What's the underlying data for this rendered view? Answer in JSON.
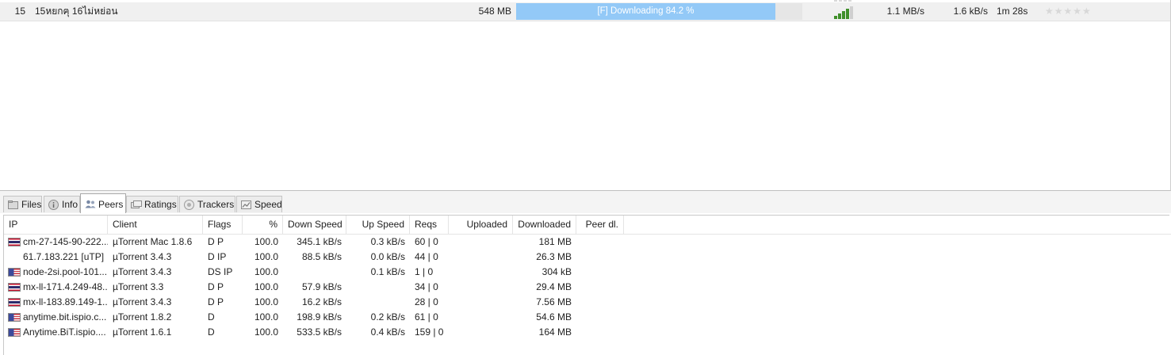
{
  "torrent": {
    "number": "15",
    "name": "15หยกฅุ 16ไม่หย่อน",
    "size": "548 MB",
    "status_text": "[F] Downloading 84.2 %",
    "progress_percent": 84.2,
    "health_bars": 4,
    "down_speed": "1.1 MB/s",
    "up_speed": "1.6 kB/s",
    "eta": "1m 28s",
    "rating_stars": "★★★★★",
    "rating_value": 0
  },
  "tabs": [
    {
      "label": "Files",
      "icon": "files-icon"
    },
    {
      "label": "Info",
      "icon": "info-icon"
    },
    {
      "label": "Peers",
      "icon": "peers-icon",
      "active": true
    },
    {
      "label": "Ratings",
      "icon": "ratings-icon"
    },
    {
      "label": "Trackers",
      "icon": "trackers-icon"
    },
    {
      "label": "Speed",
      "icon": "speed-icon"
    }
  ],
  "peers": {
    "columns": [
      "IP",
      "Client",
      "Flags",
      "%",
      "Down Speed",
      "Up Speed",
      "Reqs",
      "Uploaded",
      "Downloaded",
      "Peer dl."
    ],
    "rows": [
      {
        "flag": "th",
        "ip": "cm-27-145-90-222....",
        "client": "µTorrent Mac 1.8.6",
        "flags": "D P",
        "percent": "100.0",
        "down": "345.1 kB/s",
        "up": "0.3 kB/s",
        "reqs": "60 | 0",
        "uploaded": "",
        "downloaded": "181 MB",
        "peer_dl": ""
      },
      {
        "flag": "",
        "ip": "61.7.183.221 [uTP]",
        "client": "µTorrent 3.4.3",
        "flags": "D IP",
        "percent": "100.0",
        "down": "88.5 kB/s",
        "up": "0.0 kB/s",
        "reqs": "44 | 0",
        "uploaded": "",
        "downloaded": "26.3 MB",
        "peer_dl": ""
      },
      {
        "flag": "us",
        "ip": "node-2si.pool-101....",
        "client": "µTorrent 3.4.3",
        "flags": "DS IP",
        "percent": "100.0",
        "down": "",
        "up": "0.1 kB/s",
        "reqs": "1 | 0",
        "uploaded": "",
        "downloaded": "304 kB",
        "peer_dl": ""
      },
      {
        "flag": "th",
        "ip": "mx-ll-171.4.249-48....",
        "client": "µTorrent 3.3",
        "flags": "D P",
        "percent": "100.0",
        "down": "57.9 kB/s",
        "up": "",
        "reqs": "34 | 0",
        "uploaded": "",
        "downloaded": "29.4 MB",
        "peer_dl": ""
      },
      {
        "flag": "th",
        "ip": "mx-ll-183.89.149-1....",
        "client": "µTorrent 3.4.3",
        "flags": "D P",
        "percent": "100.0",
        "down": "16.2 kB/s",
        "up": "",
        "reqs": "28 | 0",
        "uploaded": "",
        "downloaded": "7.56 MB",
        "peer_dl": ""
      },
      {
        "flag": "us",
        "ip": "anytime.bit.ispio.c...",
        "client": "µTorrent 1.8.2",
        "flags": "D",
        "percent": "100.0",
        "down": "198.9 kB/s",
        "up": "0.2 kB/s",
        "reqs": "61 | 0",
        "uploaded": "",
        "downloaded": "54.6 MB",
        "peer_dl": ""
      },
      {
        "flag": "us",
        "ip": "Anytime.BiT.ispio....",
        "client": "µTorrent 1.6.1",
        "flags": "D",
        "percent": "100.0",
        "down": "533.5 kB/s",
        "up": "0.4 kB/s",
        "reqs": "159 | 0",
        "uploaded": "",
        "downloaded": "164 MB",
        "peer_dl": ""
      }
    ]
  },
  "colors": {
    "progress_fill": "#93c9f7",
    "progress_track": "#e6e6e6",
    "health_bar": "#3f8f2a",
    "health_bar_empty": "#cfcfcf"
  }
}
